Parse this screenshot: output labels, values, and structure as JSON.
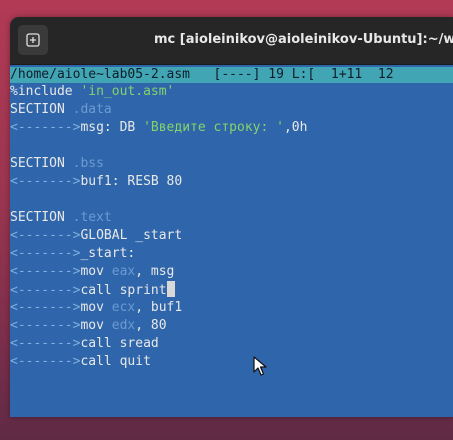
{
  "window": {
    "title": "mc [aioleinikov@aioleinikov-Ubuntu]:~/wor"
  },
  "status": {
    "path": "/home/aiole~lab05-2.asm",
    "mode": "[----]",
    "column": "19",
    "line_label": "L:[",
    "line_pos": "1+11",
    "line_num": "12"
  },
  "editor": {
    "lines": [
      {
        "parts": [
          {
            "t": "%include ",
            "c": "default"
          },
          {
            "t": "'in_out.asm'",
            "c": "str"
          }
        ]
      },
      {
        "parts": [
          {
            "t": "SECTION ",
            "c": "kw"
          },
          {
            "t": ".data",
            "c": "section-arg"
          }
        ]
      },
      {
        "parts": [
          {
            "t": "<------->",
            "c": "tab"
          },
          {
            "t": "msg: DB ",
            "c": "default"
          },
          {
            "t": "'Введите строку: '",
            "c": "str"
          },
          {
            "t": ",0h",
            "c": "default"
          }
        ]
      },
      {
        "parts": []
      },
      {
        "parts": [
          {
            "t": "SECTION ",
            "c": "kw"
          },
          {
            "t": ".bss",
            "c": "section-arg"
          }
        ]
      },
      {
        "parts": [
          {
            "t": "<------->",
            "c": "tab"
          },
          {
            "t": "buf1: RESB 80",
            "c": "default"
          }
        ]
      },
      {
        "parts": []
      },
      {
        "parts": [
          {
            "t": "SECTION ",
            "c": "kw"
          },
          {
            "t": ".text",
            "c": "section-arg"
          }
        ]
      },
      {
        "parts": [
          {
            "t": "<------->",
            "c": "tab"
          },
          {
            "t": "GLOBAL _start",
            "c": "default"
          }
        ]
      },
      {
        "parts": [
          {
            "t": "<------->",
            "c": "tab"
          },
          {
            "t": "_start:",
            "c": "default"
          }
        ]
      },
      {
        "parts": [
          {
            "t": "<------->",
            "c": "tab"
          },
          {
            "t": "mov ",
            "c": "default"
          },
          {
            "t": "eax",
            "c": "reg"
          },
          {
            "t": ", msg",
            "c": "default"
          }
        ]
      },
      {
        "parts": [
          {
            "t": "<------->",
            "c": "tab"
          },
          {
            "t": "call sprint",
            "c": "default"
          }
        ],
        "cursor": true
      },
      {
        "parts": [
          {
            "t": "<------->",
            "c": "tab"
          },
          {
            "t": "mov ",
            "c": "default"
          },
          {
            "t": "ecx",
            "c": "reg"
          },
          {
            "t": ", buf1",
            "c": "default"
          }
        ]
      },
      {
        "parts": [
          {
            "t": "<------->",
            "c": "tab"
          },
          {
            "t": "mov ",
            "c": "default"
          },
          {
            "t": "edx",
            "c": "reg"
          },
          {
            "t": ", 80",
            "c": "default"
          }
        ]
      },
      {
        "parts": [
          {
            "t": "<------->",
            "c": "tab"
          },
          {
            "t": "call sread",
            "c": "default"
          }
        ]
      },
      {
        "parts": [
          {
            "t": "<------->",
            "c": "tab"
          },
          {
            "t": "call quit",
            "c": "default"
          }
        ]
      }
    ]
  },
  "icons": {
    "new_tab": "new-tab-icon",
    "pointer": "mouse-pointer-icon"
  }
}
